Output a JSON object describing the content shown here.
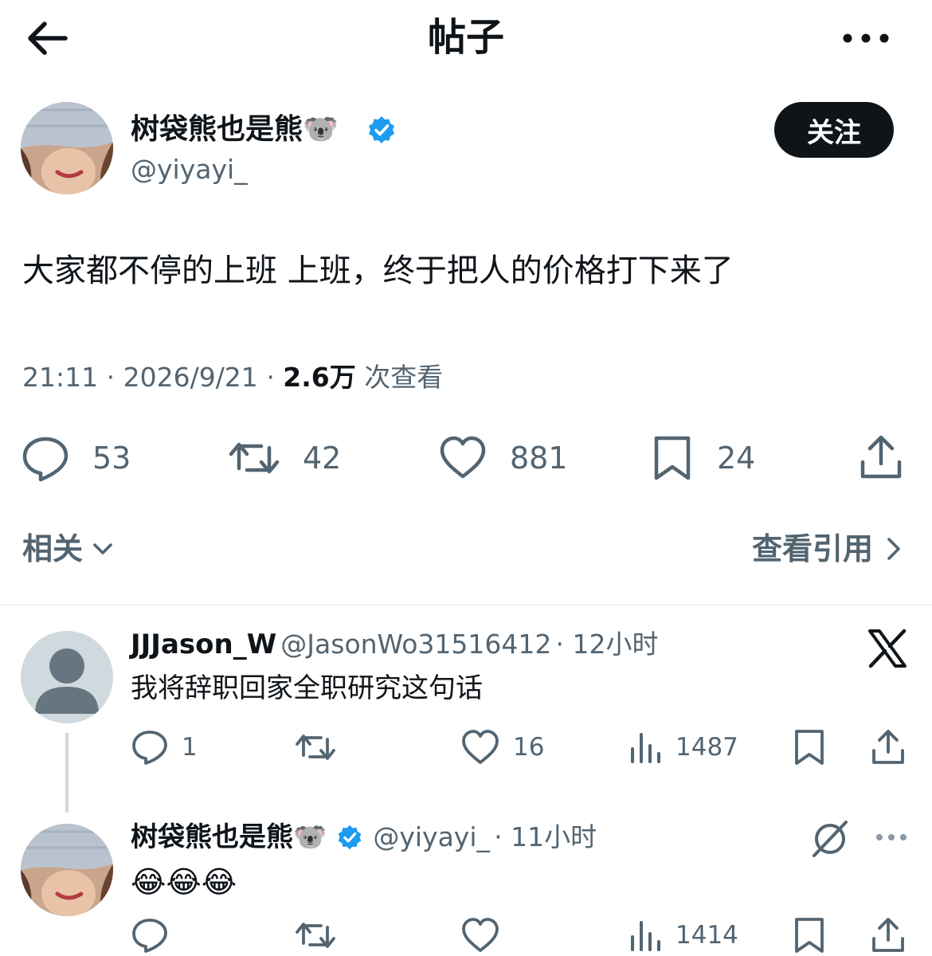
{
  "header": {
    "title": "帖子",
    "back_icon": "arrow-left-icon",
    "more_icon": "more-horizontal-icon"
  },
  "post": {
    "author_name": "树袋熊也是熊🐨",
    "handle": "@yiyayi_",
    "verified": true,
    "follow_label": "关注",
    "text": "大家都不停的上班 上班，终于把人的价格打下来了",
    "time": "21:11",
    "date": "2026/9/21",
    "views_count": "2.6万",
    "views_label": "次查看",
    "stats": {
      "replies": "53",
      "reposts": "42",
      "likes": "881",
      "bookmarks": "24"
    }
  },
  "links": {
    "related": "相关",
    "view_quotes": "查看引用"
  },
  "replies": [
    {
      "name": "JJJason_W",
      "handle": "@JasonWo31516412",
      "time": "12小时",
      "text": "我将辞职回家全职研究这句话",
      "replies": "1",
      "reposts": "",
      "likes": "16",
      "views": "1487"
    },
    {
      "name": "树袋熊也是熊🐨",
      "handle": "@yiyayi_",
      "time": "11小时",
      "text": "😂😂😂",
      "replies": "",
      "reposts": "",
      "likes": "",
      "views": "1414"
    }
  ],
  "colors": {
    "text": "#0f1419",
    "secondary": "#536471",
    "verified": "#1d9bf0",
    "divider": "#eff3f4",
    "button": "#0f1419"
  }
}
